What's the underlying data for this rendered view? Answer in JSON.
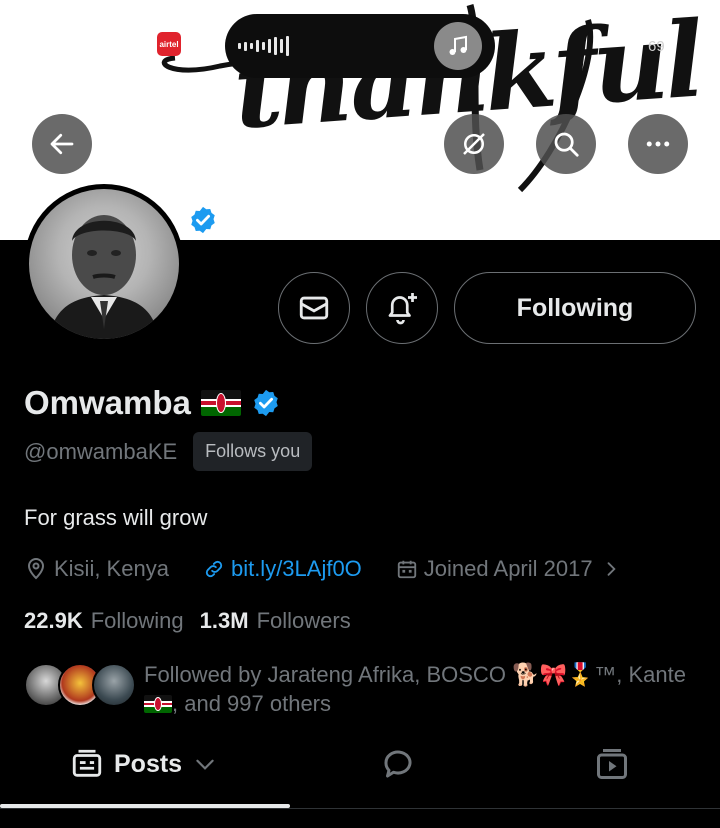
{
  "status_bar": {
    "carrier": "airtel",
    "battery": "69"
  },
  "banner": {
    "word": "thankful"
  },
  "profile": {
    "name": "Omwamba",
    "handle": "@omwambaKE",
    "follows_you": "Follows you",
    "bio": "For grass will grow",
    "location": "Kisii, Kenya",
    "link": "bit.ly/3LAjf0O",
    "joined": "Joined April 2017",
    "following_count": "22.9K",
    "following_label": "Following",
    "followers_count": "1.3M",
    "followers_label": "Followers",
    "followed_by_prefix": "Followed by Jarateng Afrika, BOSCO 🐕🎀🎖️™, Kante",
    "followed_by_suffix": ", and 997 others"
  },
  "actions": {
    "following_button": "Following"
  },
  "tabs": {
    "posts": "Posts"
  },
  "icons": {
    "back": "arrow-left-icon",
    "search_alt": "search-slash-icon",
    "search": "search-icon",
    "more": "more-icon",
    "message": "mail-icon",
    "notify": "bell-plus-icon",
    "verified": "verified-badge-icon",
    "location": "location-pin-icon",
    "link": "link-icon",
    "calendar": "calendar-icon",
    "chevron": "chevron-right-icon",
    "posts": "posts-icon",
    "dropdown": "chevron-down-icon",
    "replies": "speech-bubble-icon",
    "media": "video-icon"
  },
  "colors": {
    "accent": "#1d9bf0",
    "background": "#000000",
    "secondary_text": "#71767b"
  }
}
